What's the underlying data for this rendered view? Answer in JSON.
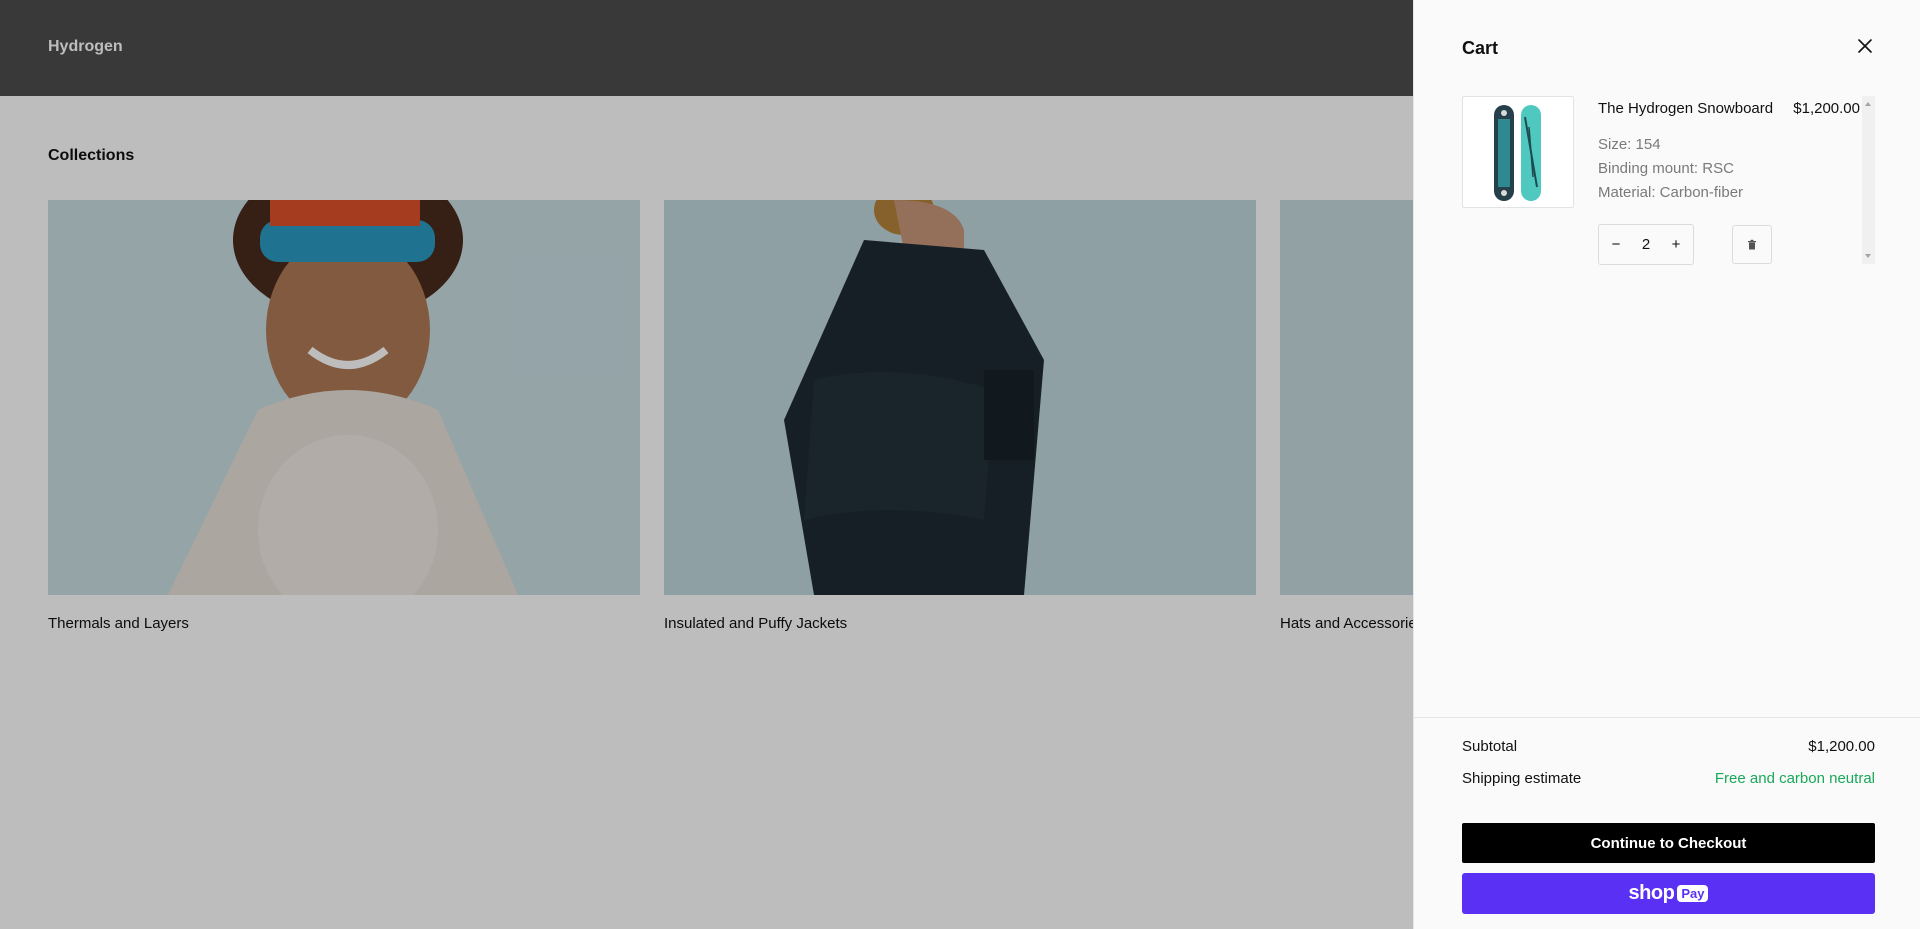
{
  "header": {
    "brand": "Hydrogen"
  },
  "collections": {
    "title": "Collections",
    "items": [
      {
        "label": "Thermals and Layers"
      },
      {
        "label": "Insulated and Puffy Jackets"
      },
      {
        "label": "Hats and Accessories"
      }
    ]
  },
  "cart": {
    "title": "Cart",
    "line_items": [
      {
        "title": "The Hydrogen Snowboard",
        "price": "$1,200.00",
        "options": [
          "Size: 154",
          "Binding mount: RSC",
          "Material: Carbon-fiber"
        ],
        "quantity": "2",
        "decrease_label": "−",
        "increase_label": "+"
      }
    ],
    "subtotal_label": "Subtotal",
    "subtotal_value": "$1,200.00",
    "shipping_label": "Shipping estimate",
    "shipping_value": "Free and carbon neutral",
    "checkout_label": "Continue to Checkout",
    "shoppay": {
      "shop": "shop",
      "pay": "Pay"
    }
  },
  "colors": {
    "header_bg": "#222222",
    "checkout_bg": "#000000",
    "shoppay_bg": "#5a31f4",
    "shipping_text": "#1aa85a"
  }
}
